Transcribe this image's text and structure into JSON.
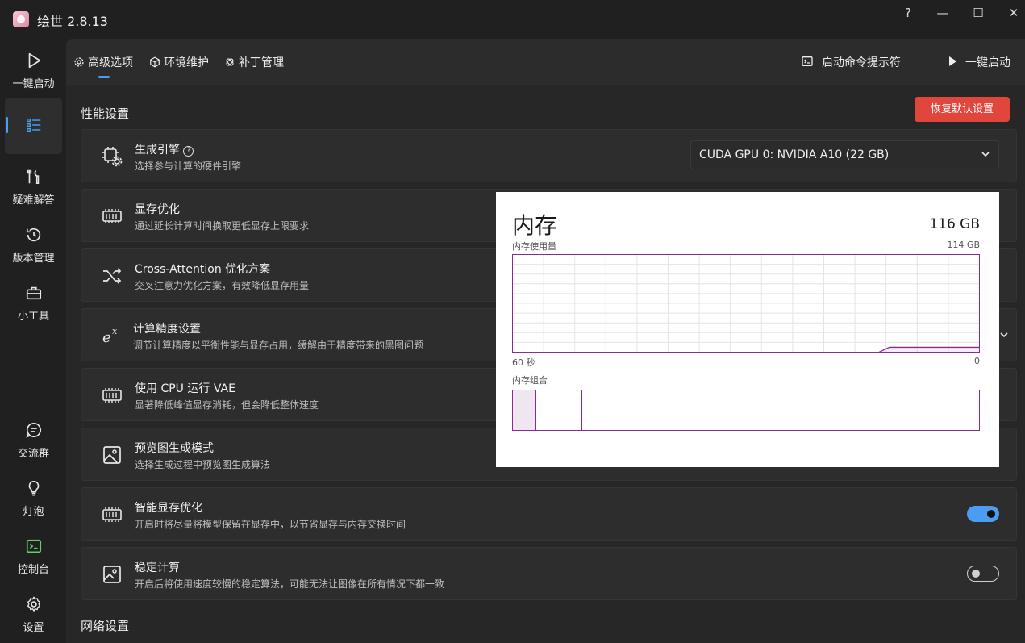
{
  "app": {
    "title": "绘世 2.8.13"
  },
  "window_controls": {
    "help": "?",
    "minimize": "—",
    "maximize": "☐",
    "close": "✕"
  },
  "sidebar": {
    "top_items": [
      {
        "label": "一键启动",
        "icon": "play-icon"
      },
      {
        "label": "",
        "icon": "list-settings-icon",
        "active": true
      },
      {
        "label": "疑难解答",
        "icon": "tools-icon"
      },
      {
        "label": "版本管理",
        "icon": "history-icon"
      },
      {
        "label": "小工具",
        "icon": "toolbox-icon"
      }
    ],
    "bottom_items": [
      {
        "label": "交流群",
        "icon": "chat-icon"
      },
      {
        "label": "灯泡",
        "icon": "lightbulb-icon"
      },
      {
        "label": "控制台",
        "icon": "console-icon"
      },
      {
        "label": "设置",
        "icon": "gear-icon"
      }
    ]
  },
  "tabs": [
    {
      "label": "高级选项",
      "icon": "gear-icon",
      "active": true
    },
    {
      "label": "环境维护",
      "icon": "cube-icon"
    },
    {
      "label": "补丁管理",
      "icon": "patch-icon"
    }
  ],
  "actions": {
    "cmd_prompt": "启动命令提示符",
    "one_click": "一键启动"
  },
  "performance": {
    "section_title": "性能设置",
    "reset_button": "恢复默认设置",
    "items": [
      {
        "title": "生成引擎",
        "desc": "选择参与计算的硬件引擎",
        "icon": "chip-gear-icon",
        "control": "select",
        "value": "CUDA GPU 0: NVIDIA A10 (22 GB)"
      },
      {
        "title": "显存优化",
        "desc": "通过延长计算时间换取更低显存上限要求",
        "icon": "memory-icon"
      },
      {
        "title": "Cross-Attention 优化方案",
        "desc": "交叉注意力优化方案，有效降低显存用量",
        "icon": "shuffle-icon"
      },
      {
        "title": "计算精度设置",
        "desc": "调节计算精度以平衡性能与显存占用，缓解由于精度带来的黑图问题",
        "icon": "exponent-icon"
      },
      {
        "title": "使用 CPU 运行 VAE",
        "desc": "显著降低峰值显存消耗，但会降低整体速度",
        "icon": "memory-icon"
      },
      {
        "title": "预览图生成模式",
        "desc": "选择生成过程中预览图生成算法",
        "icon": "image-icon"
      },
      {
        "title": "智能显存优化",
        "desc": "开启时将尽量将模型保留在显存中，以节省显存与内存交换时间",
        "icon": "memory-icon",
        "toggle": true
      },
      {
        "title": "稳定计算",
        "desc": "开启后将使用速度较慢的稳定算法，可能无法让图像在所有情况下都一致",
        "icon": "image-edit-icon",
        "toggle": false
      }
    ]
  },
  "network": {
    "section_title": "网络设置"
  },
  "memory_panel": {
    "title": "内存",
    "total": "116 GB",
    "usage_label": "内存使用量",
    "usage_max": "114 GB",
    "time_left": "60 秒",
    "time_right": "0",
    "composition_label": "内存组合",
    "usage_fraction_now": 0.05,
    "accent": "#8a2b94"
  },
  "colors": {
    "accent": "#4a9df0",
    "danger": "#e0463c"
  }
}
